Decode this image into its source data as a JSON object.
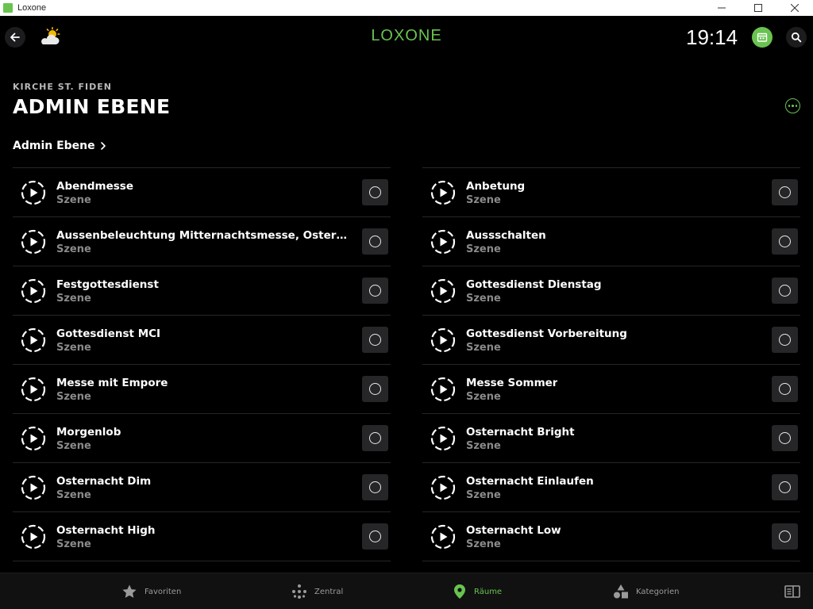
{
  "window": {
    "title": "Loxone"
  },
  "header": {
    "logo": "LOXONE",
    "clock": "19:14",
    "icons": {
      "back": "arrow-left-icon",
      "weather": "partly-cloudy-icon",
      "notifications": "calendar-icon",
      "search": "search-icon"
    }
  },
  "location": "KIRCHE ST. FIDEN",
  "page_title": "ADMIN EBENE",
  "breadcrumb": "Admin Ebene",
  "colors": {
    "accent": "#69c350",
    "background": "#000000",
    "row_button": "#262628",
    "subtitle": "#8a8a8a"
  },
  "scenes": {
    "left": [
      {
        "name": "Abendmesse",
        "type": "Szene"
      },
      {
        "name": "Aussenbeleuchtung Mitternachtsmesse, Ostermesse und Rorate",
        "type": "Szene"
      },
      {
        "name": "Festgottesdienst",
        "type": "Szene"
      },
      {
        "name": "Gottesdienst MCI",
        "type": "Szene"
      },
      {
        "name": "Messe mit Empore",
        "type": "Szene"
      },
      {
        "name": "Morgenlob",
        "type": "Szene"
      },
      {
        "name": "Osternacht Dim",
        "type": "Szene"
      },
      {
        "name": "Osternacht High",
        "type": "Szene"
      }
    ],
    "right": [
      {
        "name": "Anbetung",
        "type": "Szene"
      },
      {
        "name": "Aussschalten",
        "type": "Szene"
      },
      {
        "name": "Gottesdienst Dienstag",
        "type": "Szene"
      },
      {
        "name": "Gottesdienst Vorbereitung",
        "type": "Szene"
      },
      {
        "name": "Messe Sommer",
        "type": "Szene"
      },
      {
        "name": "Osternacht Bright",
        "type": "Szene"
      },
      {
        "name": "Osternacht Einlaufen",
        "type": "Szene"
      },
      {
        "name": "Osternacht Low",
        "type": "Szene"
      }
    ]
  },
  "tabs": [
    {
      "label": "Favoriten",
      "icon": "star-icon"
    },
    {
      "label": "Zentral",
      "icon": "dots-grid-icon"
    },
    {
      "label": "Räume",
      "icon": "location-pin-icon",
      "active": true
    },
    {
      "label": "Kategorien",
      "icon": "shapes-icon"
    }
  ]
}
